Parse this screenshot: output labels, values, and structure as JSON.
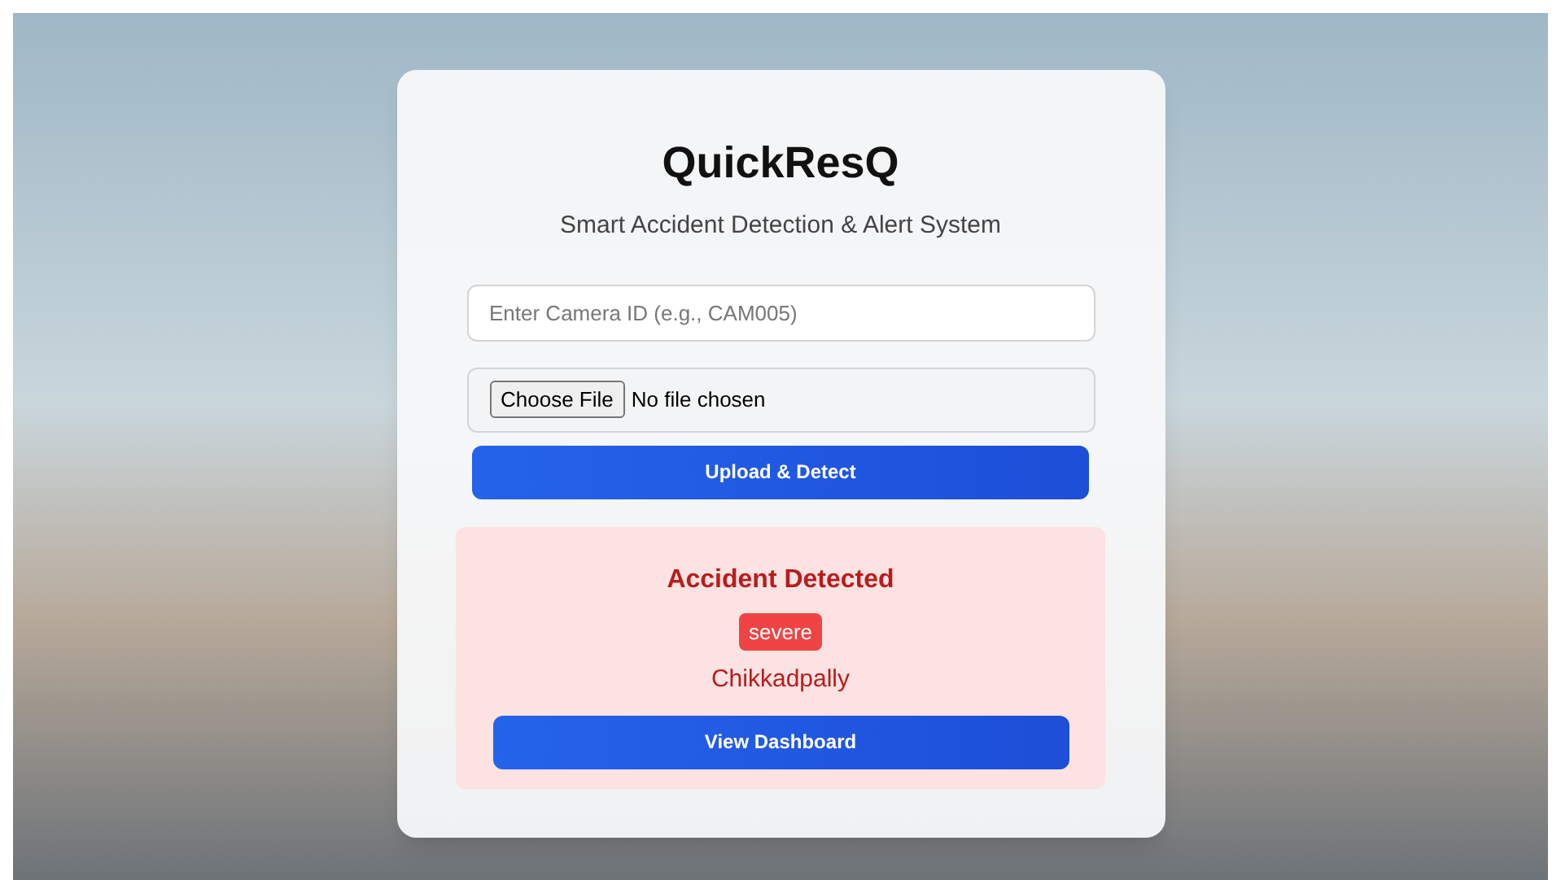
{
  "app": {
    "title": "QuickResQ",
    "subtitle": "Smart Accident Detection & Alert System"
  },
  "camera_field": {
    "placeholder": "Enter Camera ID (e.g., CAM005)"
  },
  "file_input": {
    "button": "Choose File",
    "status": "No file chosen"
  },
  "upload_button": "Upload & Detect",
  "result": {
    "title": "Accident Detected",
    "severity": "severe",
    "location": "Chikkadpally",
    "button": "View Dashboard"
  }
}
